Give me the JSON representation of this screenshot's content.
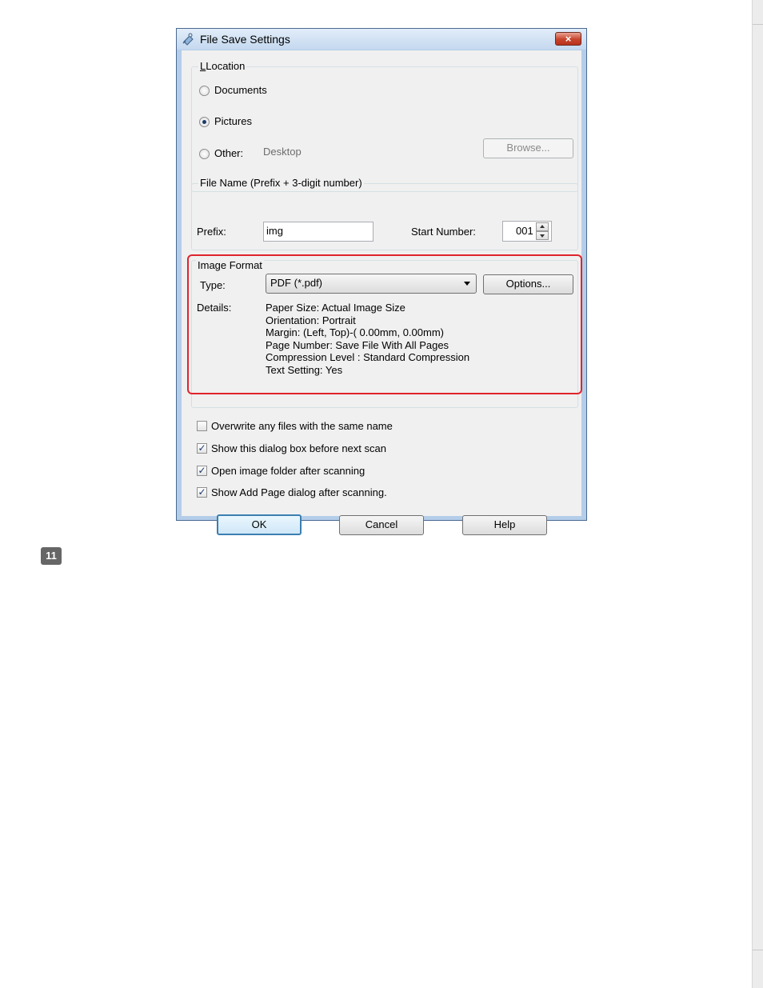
{
  "dialog": {
    "title": "File Save Settings",
    "close_label": "×",
    "location": {
      "title": "Location",
      "documents_label": "Documents",
      "pictures_label": "Pictures",
      "other_label": "Other:",
      "other_path": "Desktop",
      "browse_label": "Browse...",
      "selected": "Pictures"
    },
    "file_name": {
      "title": "File Name (Prefix + 3-digit number)",
      "prefix_label": "Prefix:",
      "prefix_value": "img",
      "start_number_label": "Start Number:",
      "start_number_value": "001"
    },
    "image_format": {
      "title": "Image Format",
      "type_label": "Type:",
      "type_value": "PDF (*.pdf)",
      "options_label": "Options...",
      "details_label": "Details:",
      "details": [
        "Paper Size: Actual Image Size",
        "Orientation: Portrait",
        "Margin: (Left, Top)-( 0.00mm, 0.00mm)",
        "Page Number: Save File With All Pages",
        "Compression Level : Standard Compression",
        "Text Setting: Yes"
      ]
    },
    "checkboxes": [
      {
        "label": "Overwrite any files with the same name",
        "checked": false
      },
      {
        "label": "Show this dialog box before next scan",
        "checked": true
      },
      {
        "label": "Open image folder after scanning",
        "checked": true
      },
      {
        "label": "Show Add Page dialog after scanning.",
        "checked": true
      }
    ],
    "buttons": {
      "ok": "OK",
      "cancel": "Cancel",
      "help": "Help"
    }
  },
  "step_number": "11",
  "colors": {
    "highlight": "#e0242d",
    "frame": "#b4cde8",
    "client": "#f0f0f0"
  }
}
